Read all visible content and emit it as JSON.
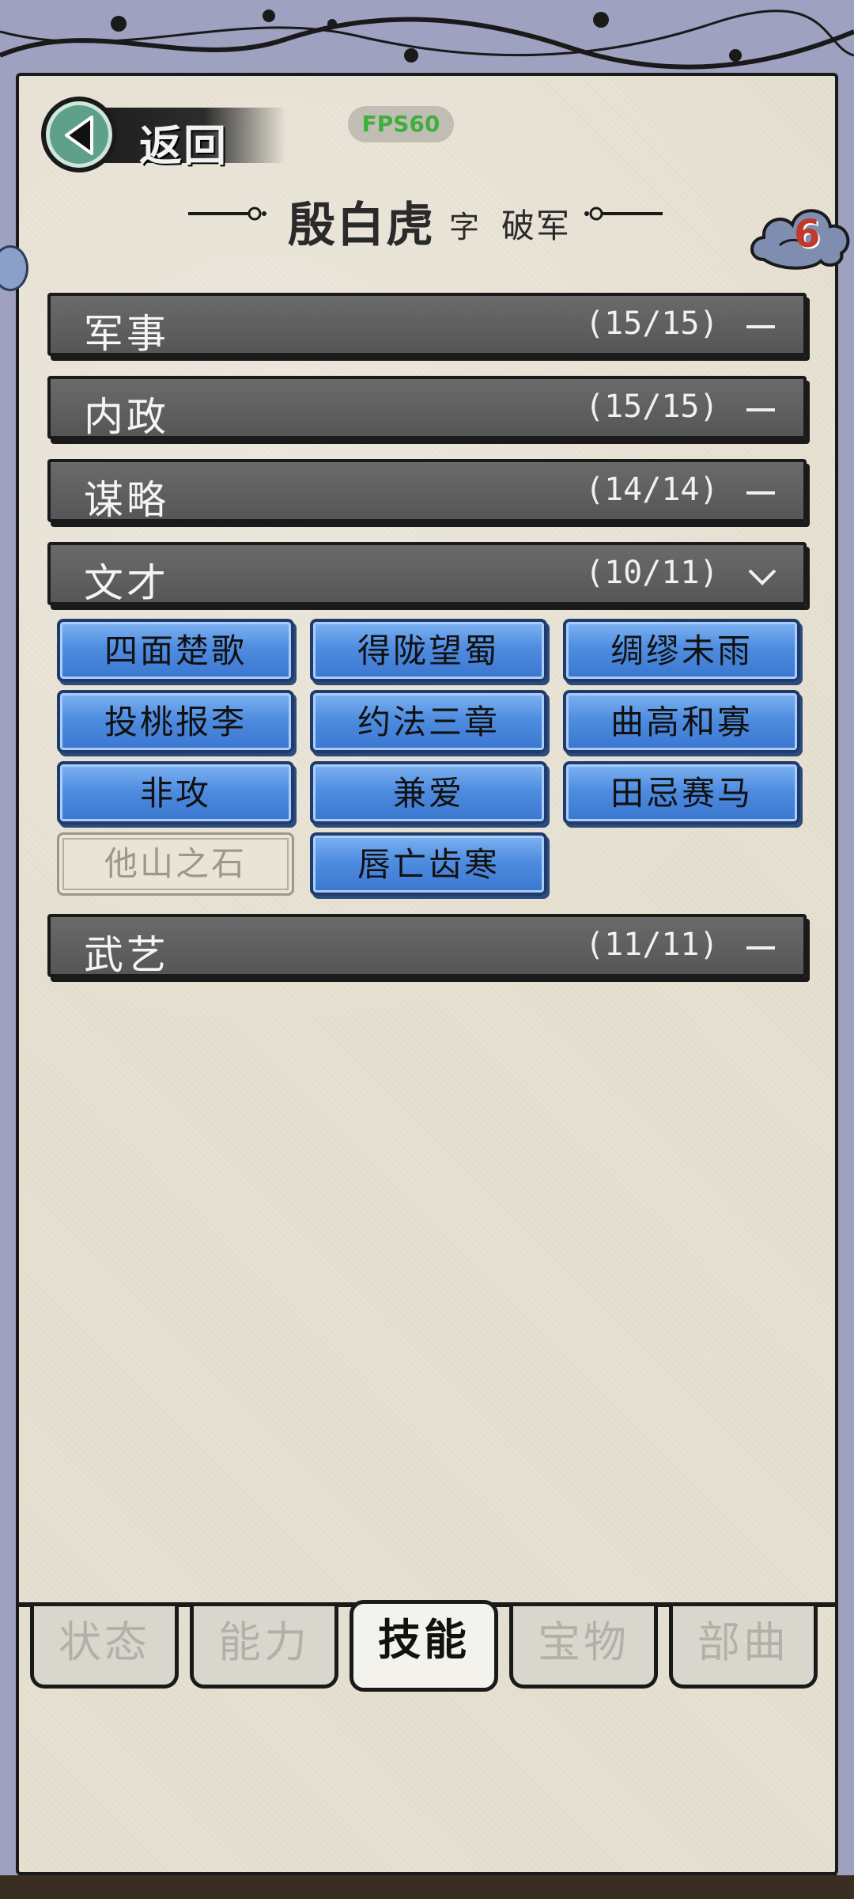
{
  "header": {
    "back_label": "返回",
    "fps": "FPS60",
    "name": "殷白虎",
    "zi_label": "字",
    "courtesy_name": "破军",
    "cloud_badge": "6"
  },
  "categories": [
    {
      "label": "军事",
      "count": "(15/15)",
      "state": "collapsed"
    },
    {
      "label": "内政",
      "count": "(15/15)",
      "state": "collapsed"
    },
    {
      "label": "谋略",
      "count": "(14/14)",
      "state": "collapsed"
    },
    {
      "label": "文才",
      "count": "(10/11)",
      "state": "expanded"
    },
    {
      "label": "武艺",
      "count": "(11/11)",
      "state": "collapsed"
    }
  ],
  "skills": [
    {
      "label": "四面楚歌",
      "learned": true
    },
    {
      "label": "得陇望蜀",
      "learned": true
    },
    {
      "label": "绸缪未雨",
      "learned": true
    },
    {
      "label": "投桃报李",
      "learned": true
    },
    {
      "label": "约法三章",
      "learned": true
    },
    {
      "label": "曲高和寡",
      "learned": true
    },
    {
      "label": "非攻",
      "learned": true
    },
    {
      "label": "兼爱",
      "learned": true
    },
    {
      "label": "田忌赛马",
      "learned": true
    },
    {
      "label": "他山之石",
      "learned": false
    },
    {
      "label": "唇亡齿寒",
      "learned": true
    }
  ],
  "tabs": [
    {
      "label": "状态",
      "active": false
    },
    {
      "label": "能力",
      "active": false
    },
    {
      "label": "技能",
      "active": true
    },
    {
      "label": "宝物",
      "active": false
    },
    {
      "label": "部曲",
      "active": false
    }
  ],
  "colors": {
    "skill_learned": "#4f8de0",
    "skill_unlearned": "#e9e4d6",
    "category_bar": "#5e5e5e",
    "parchment": "#e6e0d1",
    "frame": "#9ea1bf",
    "fps_text": "#3fae3f",
    "badge_number": "#c0392b"
  }
}
